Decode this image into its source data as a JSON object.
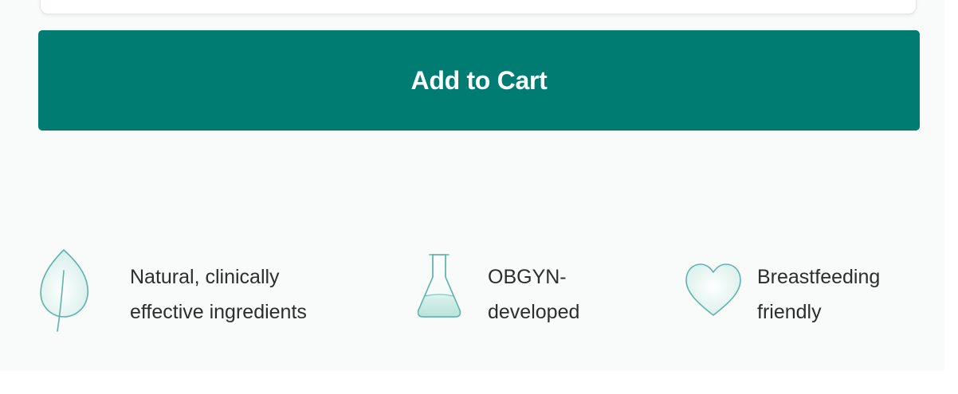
{
  "cart": {
    "button_label": "Add to Cart",
    "color": "#007c72"
  },
  "features": [
    {
      "icon": "leaf-icon",
      "line1": "Natural, clinically",
      "line2": "effective ingredients"
    },
    {
      "icon": "flask-icon",
      "line1": "OBGYN-",
      "line2": "developed"
    },
    {
      "icon": "heart-icon",
      "line1": "Breastfeeding",
      "line2": "friendly"
    }
  ],
  "colors": {
    "background": "#f9fafa",
    "icon_stroke": "#5fb3aa",
    "icon_fill": "#dff2ef",
    "text": "#2d2d2d"
  }
}
